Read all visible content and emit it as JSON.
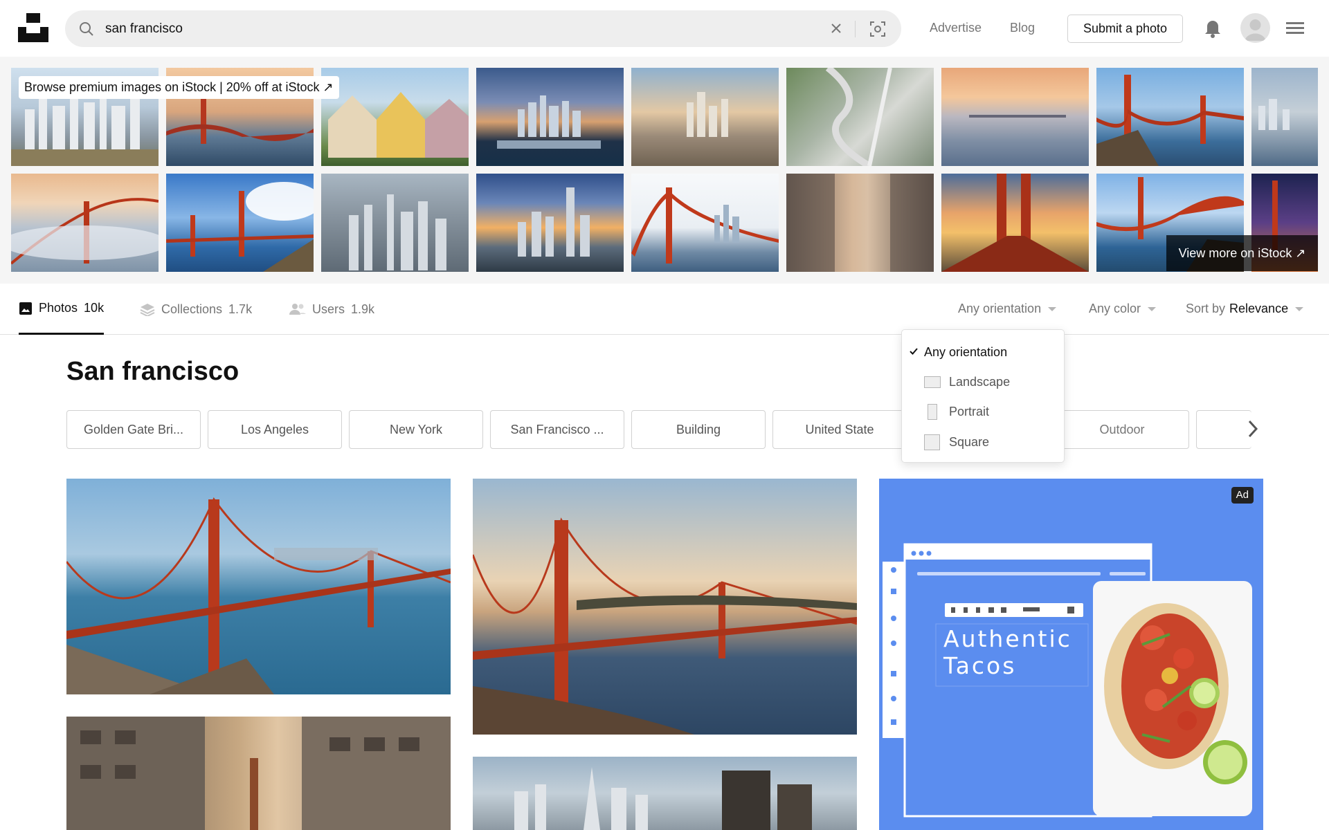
{
  "header": {
    "search_value": "san francisco",
    "nav_links": [
      "Advertise",
      "Blog"
    ],
    "submit_label": "Submit a photo"
  },
  "istock": {
    "promo": "Browse premium images on iStock | 20% off at iStock ↗",
    "view_more": "View more on iStock ↗"
  },
  "tabs": [
    {
      "label": "Photos",
      "count": "10k"
    },
    {
      "label": "Collections",
      "count": "1.7k"
    },
    {
      "label": "Users",
      "count": "1.9k"
    }
  ],
  "filters": {
    "orientation": "Any orientation",
    "color": "Any color",
    "sort_prefix": "Sort by",
    "sort_value": "Relevance"
  },
  "page_title": "San francisco",
  "related_chips": [
    "Golden Gate Bri...",
    "Los Angeles",
    "New York",
    "San Francisco ...",
    "Building",
    "United State",
    "Outdoor"
  ],
  "orientation_menu": {
    "items": [
      "Any orientation",
      "Landscape",
      "Portrait",
      "Square"
    ],
    "selected": "Any orientation"
  },
  "ad": {
    "badge": "Ad",
    "headline_line1": "Authentic",
    "headline_line2": "Tacos"
  },
  "colors": {
    "accent": "#111111",
    "muted": "#767676",
    "ad_blue": "#5b8def"
  }
}
